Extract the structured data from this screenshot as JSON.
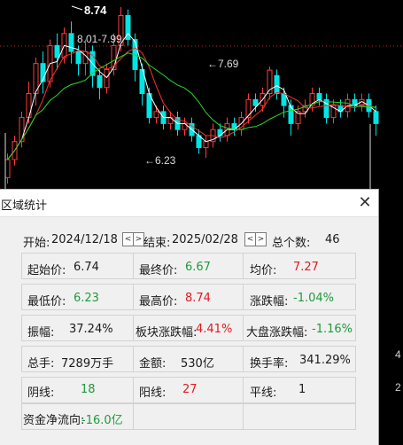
{
  "chart": {
    "high_label": "8.74",
    "range_label": "8.01-7.99",
    "mid_label": "←7.69",
    "low_label": "←6.23",
    "right_ticks": [
      "4",
      "2"
    ],
    "colors": {
      "up": "#ff3b3b",
      "down": "#00e5e5",
      "ma_white": "#ffffff",
      "ma_red": "#ff3030",
      "ma_green": "#22dd22",
      "dotted": "#cc2222"
    },
    "candles": [
      [
        5.9,
        6.2,
        5.8,
        6.3
      ],
      [
        6.2,
        6.5,
        6.1,
        6.6
      ],
      [
        6.5,
        6.9,
        6.4,
        7.0
      ],
      [
        6.9,
        7.3,
        6.8,
        7.5
      ],
      [
        7.3,
        7.8,
        7.1,
        7.9
      ],
      [
        7.8,
        7.5,
        7.3,
        8.0
      ],
      [
        7.5,
        8.1,
        7.4,
        8.2
      ],
      [
        8.1,
        7.9,
        7.7,
        8.3
      ],
      [
        7.9,
        8.3,
        7.8,
        8.4
      ],
      [
        8.3,
        8.0,
        7.8,
        8.5
      ],
      [
        8.0,
        7.8,
        7.6,
        8.1
      ],
      [
        7.8,
        8.0,
        7.6,
        8.2
      ],
      [
        8.0,
        7.6,
        7.4,
        8.1
      ],
      [
        7.6,
        7.4,
        7.2,
        7.7
      ],
      [
        7.4,
        7.7,
        7.3,
        7.8
      ],
      [
        7.7,
        8.1,
        7.6,
        8.3
      ],
      [
        8.1,
        8.6,
        8.0,
        8.74
      ],
      [
        8.6,
        8.2,
        8.1,
        8.7
      ],
      [
        8.2,
        7.7,
        7.5,
        8.3
      ],
      [
        7.7,
        7.3,
        7.1,
        7.8
      ],
      [
        7.3,
        6.9,
        6.8,
        7.4
      ],
      [
        6.9,
        7.0,
        6.8,
        7.1
      ],
      [
        7.0,
        6.8,
        6.7,
        7.1
      ],
      [
        6.8,
        6.9,
        6.7,
        7.0
      ],
      [
        6.9,
        6.7,
        6.6,
        7.0
      ],
      [
        6.7,
        6.8,
        6.6,
        6.9
      ],
      [
        6.8,
        6.6,
        6.5,
        6.9
      ],
      [
        6.6,
        6.4,
        6.3,
        6.7
      ],
      [
        6.4,
        6.5,
        6.23,
        6.6
      ],
      [
        6.5,
        6.7,
        6.4,
        6.8
      ],
      [
        6.7,
        6.6,
        6.5,
        6.8
      ],
      [
        6.6,
        6.8,
        6.5,
        6.9
      ],
      [
        6.8,
        6.7,
        6.6,
        6.9
      ],
      [
        6.7,
        6.9,
        6.6,
        7.0
      ],
      [
        6.9,
        7.2,
        6.8,
        7.3
      ],
      [
        7.2,
        7.1,
        7.0,
        7.3
      ],
      [
        7.1,
        7.3,
        7.0,
        7.4
      ],
      [
        7.3,
        7.69,
        7.2,
        7.75
      ],
      [
        7.6,
        7.3,
        7.2,
        7.7
      ],
      [
        7.3,
        7.1,
        6.9,
        7.4
      ],
      [
        7.1,
        6.8,
        6.6,
        7.2
      ],
      [
        6.8,
        7.0,
        6.7,
        7.1
      ],
      [
        7.0,
        7.1,
        6.9,
        7.2
      ],
      [
        7.1,
        7.3,
        7.0,
        7.4
      ],
      [
        7.3,
        7.2,
        7.1,
        7.4
      ],
      [
        7.2,
        6.9,
        6.8,
        7.3
      ],
      [
        6.9,
        7.1,
        6.8,
        7.2
      ],
      [
        7.1,
        7.0,
        6.9,
        7.2
      ],
      [
        7.0,
        7.2,
        6.9,
        7.3
      ],
      [
        7.2,
        7.1,
        7.0,
        7.3
      ],
      [
        7.1,
        7.2,
        7.0,
        7.3
      ],
      [
        7.2,
        7.0,
        6.9,
        7.3
      ],
      [
        7.0,
        6.8,
        6.6,
        7.1
      ]
    ]
  },
  "dialog": {
    "title": "区域统计",
    "close_symbol": "✕",
    "start_label": "开始:",
    "start_value": "2024/12/18",
    "prev_btn": "<",
    "next_btn": ">",
    "end_label": "结束:",
    "end_value": "2025/02/28",
    "count_label": "总个数:",
    "count_value": "46",
    "stats": {
      "open_label": "起始价:",
      "open_value": "6.74",
      "close_label": "最终价:",
      "close_value": "6.67",
      "avg_label": "均价:",
      "avg_value": "7.27",
      "low_label": "最低价:",
      "low_value": "6.23",
      "high_label": "最高价:",
      "high_value": "8.74",
      "chg_label": "涨跌幅:",
      "chg_value": "-1.04%",
      "amp_label": "振幅:",
      "amp_value": "37.24%",
      "sector_label": "板块涨跌幅:",
      "sector_value": "4.41%",
      "market_label": "大盘涨跌幅:",
      "market_value": "-1.16%",
      "vol_label": "总手:",
      "vol_value": "7289万手",
      "amt_label": "金额:",
      "amt_value": "530亿",
      "turn_label": "换手率:",
      "turn_value": "341.29%",
      "down_label": "阴线:",
      "down_value": "18",
      "up_label": "阳线:",
      "up_value": "27",
      "flat_label": "平线:",
      "flat_value": "1",
      "flow_label": "资金净流向:",
      "flow_value": "-16.0亿"
    }
  }
}
